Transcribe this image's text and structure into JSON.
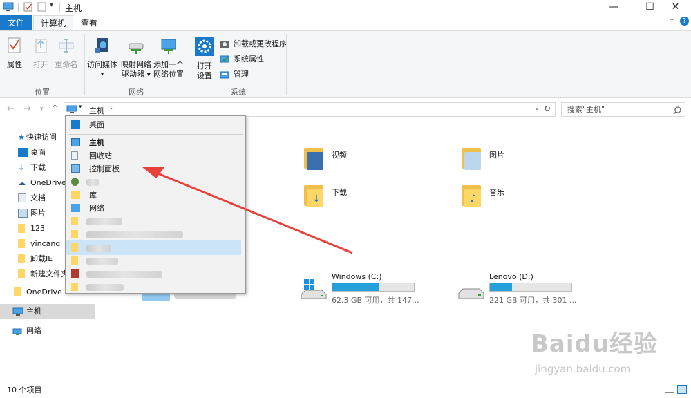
{
  "window": {
    "title": "主机",
    "minimize": "—",
    "maximize": "☐",
    "close": "✕"
  },
  "ribbon": {
    "tabs": {
      "file": "文件",
      "computer": "计算机",
      "view": "查看"
    },
    "location": {
      "properties": "属性",
      "open": "打开",
      "rename": "重命名",
      "group": "位置"
    },
    "network": {
      "media": "访问媒体",
      "map_line1": "映射网络",
      "map_line2": "驱动器 ▾",
      "add_line1": "添加一个",
      "add_line2": "网络位置",
      "group": "网络"
    },
    "system": {
      "settings_line1": "打开",
      "settings_line2": "设置",
      "uninstall": "卸载或更改程序",
      "sysprops": "系统属性",
      "manage": "管理",
      "group": "系统"
    }
  },
  "nav": {
    "back": "←",
    "forward": "→",
    "up_arrow": "↑",
    "breadcrumb": "主机",
    "search_placeholder": "搜索\"主机\""
  },
  "sidebar": {
    "quick_access": "快速访问",
    "items": [
      "桌面",
      "下载",
      "OneDrive",
      "文档",
      "图片",
      "123",
      "yincang",
      "卸载IE",
      "新建文件夹"
    ],
    "onedrive": "OneDrive",
    "this_pc": "主机",
    "network": "网络"
  },
  "dropdown": {
    "items": [
      "桌面",
      "主机",
      "回收站",
      "控制面板",
      "",
      "库",
      "网络",
      "",
      "",
      "",
      "",
      "",
      ""
    ]
  },
  "content": {
    "folders": [
      "视频",
      "图片",
      "下载",
      "音乐"
    ],
    "drives": [
      {
        "name": "Windows (C:)",
        "info": "62.3 GB 可用，共 147...",
        "used_fraction": 0.58
      },
      {
        "name": "Lenovo (D:)",
        "info": "221 GB 可用，共 301 ...",
        "used_fraction": 0.27
      }
    ]
  },
  "status": {
    "count": "10 个项目"
  },
  "watermark": {
    "text": "Baidu经验",
    "url": "jingyan.baidu.com"
  },
  "colors": {
    "accent": "#1979ca",
    "arrow": "#e8413c",
    "selection": "#cce4f7",
    "drive_fill": "#26a0da"
  }
}
